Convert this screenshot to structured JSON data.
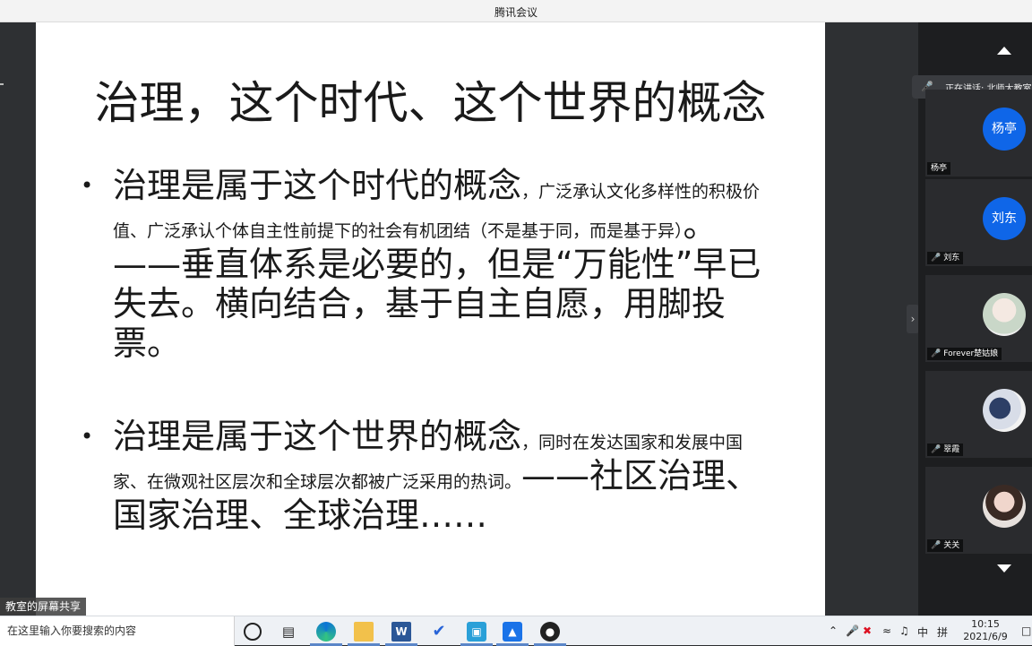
{
  "window": {
    "title": "腾讯会议"
  },
  "slide": {
    "title": "治理，这个时代、这个世界的概念",
    "bullets": [
      {
        "marker": "•",
        "heading": "治理是属于这个时代的概念",
        "detail": "，广泛承认文化多样性的积极价值、广泛承认个体自主性前提下的社会有机团结（不是基于同，而是基于异）",
        "emphasis": "。——垂直体系是必要的，但是“万能性”早已失去。横向结合，基于自主自愿，用脚投票。"
      },
      {
        "marker": "•",
        "heading": "治理是属于这个世界的概念",
        "detail": "，同时在发达国家和发展中国家、在微观社区层次和全球层次都被广泛采用的热词。",
        "emphasis": "——社区治理、国家治理、全球治理……"
      }
    ]
  },
  "share_label": "教室的屏幕共享",
  "panel": {
    "collapse_icon": "›",
    "speaking_text": "正在讲话: 北师大教室",
    "participants": [
      {
        "name": "杨亭",
        "avatar_text": "杨亭",
        "avatar": "blue"
      },
      {
        "name": "刘东",
        "avatar_text": "刘东",
        "avatar": "blue"
      },
      {
        "name": "Forever楚姑娘",
        "avatar_text": "",
        "avatar": "photo1"
      },
      {
        "name": "翠霞",
        "avatar_text": "",
        "avatar": "photo2"
      },
      {
        "name": "关关",
        "avatar_text": "",
        "avatar": "photo3"
      }
    ]
  },
  "taskbar": {
    "search_placeholder": "在这里输入你要搜索的内容",
    "word_icon_text": "W",
    "tray": {
      "ime": "中",
      "layout": "拼"
    },
    "time": "10:15",
    "date": "2021/6/9"
  }
}
